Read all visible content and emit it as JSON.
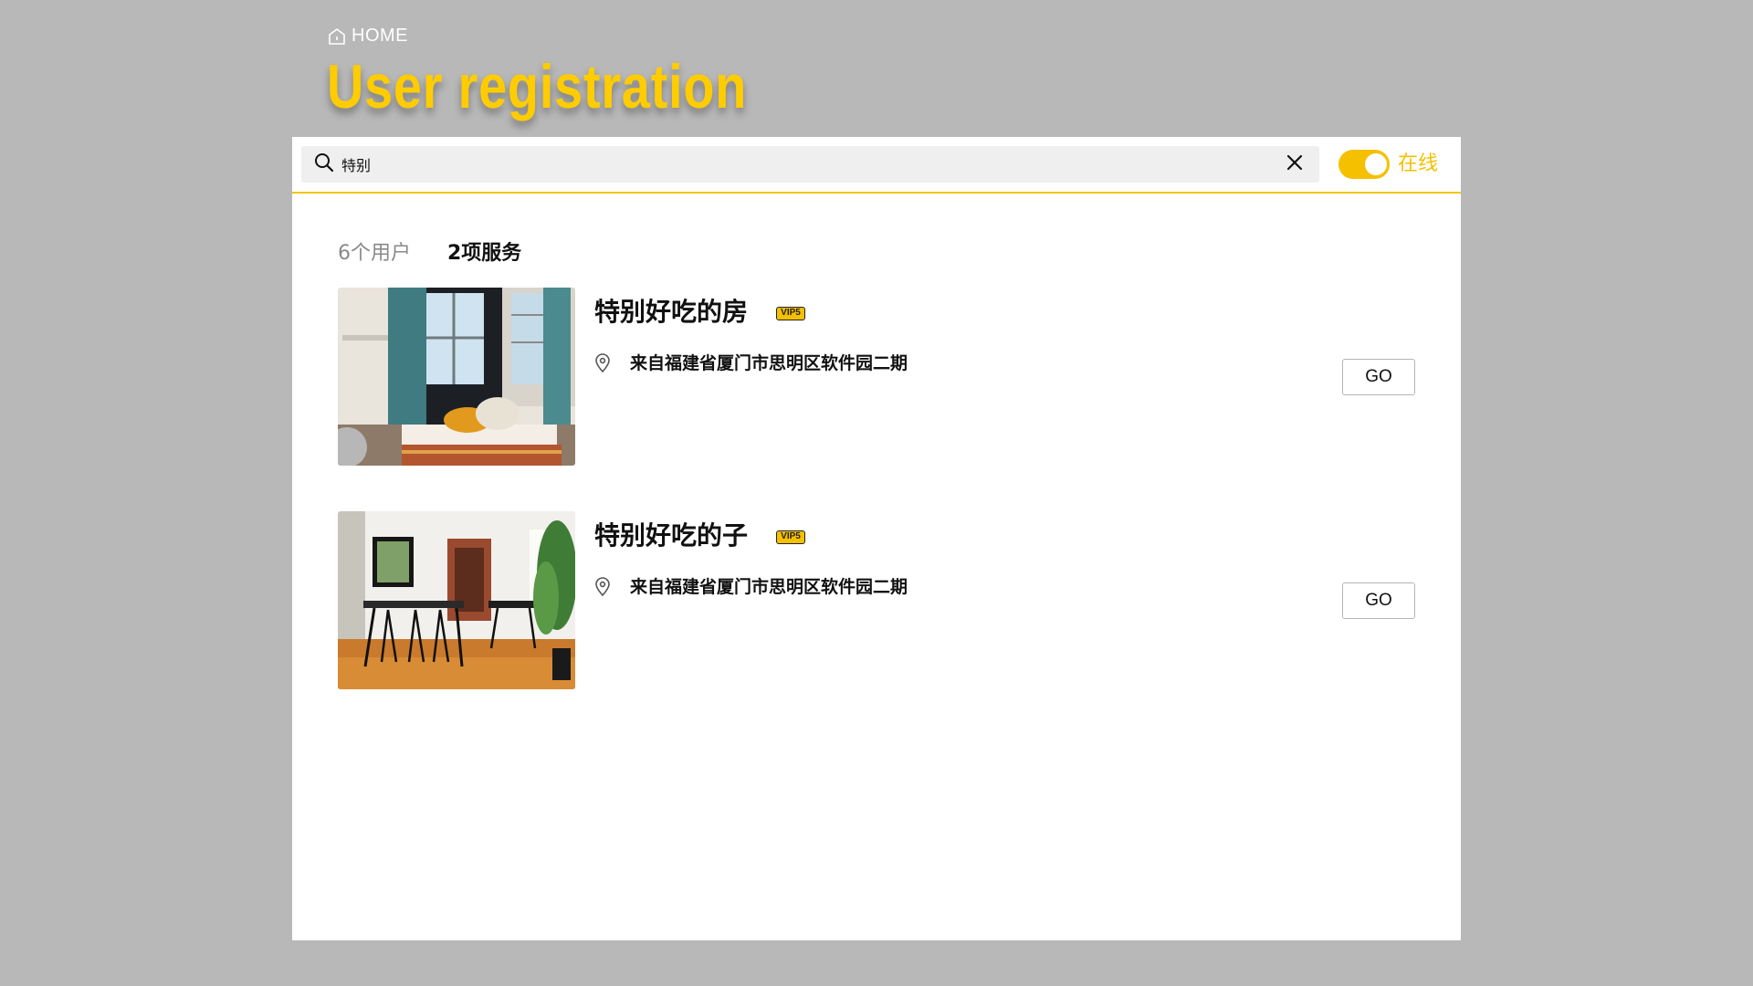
{
  "breadcrumb": {
    "icon": "home-icon",
    "label": "HOME"
  },
  "page_title": "User registration",
  "search": {
    "value": "特别",
    "icon": "search-icon",
    "clear_icon": "close-icon"
  },
  "toggle": {
    "label": "在线",
    "state": "on"
  },
  "tabs": [
    {
      "label": "6个用户",
      "active": false
    },
    {
      "label": "2项服务",
      "active": true
    }
  ],
  "results": [
    {
      "title": "特别好吃的房",
      "badge": "VIP5",
      "location_icon": "map-pin-icon",
      "address": "来自福建省厦门市思明区软件园二期",
      "button": "GO"
    },
    {
      "title": "特别好吃的子",
      "badge": "VIP5",
      "location_icon": "map-pin-icon",
      "address": "来自福建省厦门市思明区软件园二期",
      "button": "GO"
    }
  ],
  "colors": {
    "accent": "#f5c000",
    "background": "#b8b8b8",
    "panel": "#ffffff"
  }
}
